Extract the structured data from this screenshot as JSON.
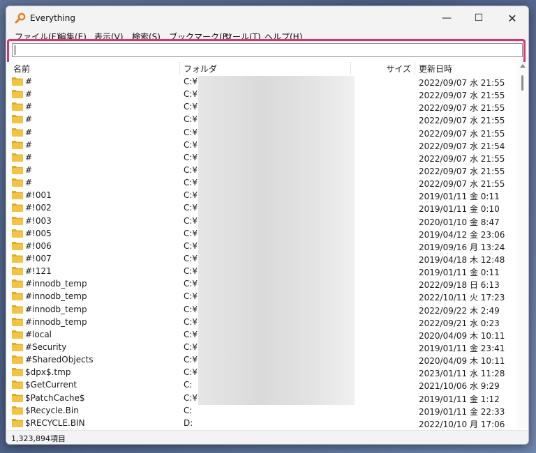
{
  "window": {
    "title": "Everything",
    "controls": {
      "minimize": "—",
      "maximize": "☐",
      "close": "✕"
    }
  },
  "menu": [
    "ファイル(F)",
    "編集(E)",
    "表示(V)",
    "検索(S)",
    "ブックマーク(B)",
    "ツール(T)",
    "ヘルプ(H)"
  ],
  "search": {
    "value": "",
    "placeholder": ""
  },
  "columns": {
    "name": "名前",
    "folder": "フォルダ",
    "size": "サイズ",
    "modified": "更新日時"
  },
  "rows": [
    {
      "name": "#",
      "folder": "C:¥",
      "modified": "2022/09/07 水 21:55"
    },
    {
      "name": "#",
      "folder": "C:¥",
      "modified": "2022/09/07 水 21:55"
    },
    {
      "name": "#",
      "folder": "C:¥",
      "modified": "2022/09/07 水 21:55"
    },
    {
      "name": "#",
      "folder": "C:¥",
      "modified": "2022/09/07 水 21:55"
    },
    {
      "name": "#",
      "folder": "C:¥",
      "modified": "2022/09/07 水 21:55"
    },
    {
      "name": "#",
      "folder": "C:¥",
      "modified": "2022/09/07 水 21:54"
    },
    {
      "name": "#",
      "folder": "C:¥",
      "modified": "2022/09/07 水 21:55"
    },
    {
      "name": "#",
      "folder": "C:¥",
      "modified": "2022/09/07 水 21:55"
    },
    {
      "name": "#",
      "folder": "C:¥",
      "modified": "2022/09/07 水 21:55"
    },
    {
      "name": "#!001",
      "folder": "C:¥",
      "modified": "2019/01/11 金 0:11"
    },
    {
      "name": "#!002",
      "folder": "C:¥",
      "modified": "2019/01/11 金 0:10"
    },
    {
      "name": "#!003",
      "folder": "C:¥",
      "modified": "2020/01/10 金 8:47"
    },
    {
      "name": "#!005",
      "folder": "C:¥",
      "modified": "2019/04/12 金 23:06"
    },
    {
      "name": "#!006",
      "folder": "C:¥",
      "modified": "2019/09/16 月 13:24"
    },
    {
      "name": "#!007",
      "folder": "C:¥",
      "modified": "2019/04/18 木 12:48"
    },
    {
      "name": "#!121",
      "folder": "C:¥",
      "modified": "2019/01/11 金 0:11"
    },
    {
      "name": "#innodb_temp",
      "folder": "C:¥",
      "modified": "2022/09/18 日 6:13"
    },
    {
      "name": "#innodb_temp",
      "folder": "C:¥",
      "modified": "2022/10/11 火 17:23"
    },
    {
      "name": "#innodb_temp",
      "folder": "C:¥",
      "modified": "2022/09/22 木 2:49"
    },
    {
      "name": "#innodb_temp",
      "folder": "C:¥",
      "modified": "2022/09/21 水 0:23"
    },
    {
      "name": "#local",
      "folder": "C:¥",
      "modified": "2020/04/09 木 10:11"
    },
    {
      "name": "#Security",
      "folder": "C:¥",
      "modified": "2019/01/11 金 23:41"
    },
    {
      "name": "#SharedObjects",
      "folder": "C:¥",
      "modified": "2020/04/09 木 10:11"
    },
    {
      "name": "$dpx$.tmp",
      "folder": "C:¥",
      "modified": "2023/01/11 水 11:28"
    },
    {
      "name": "$GetCurrent",
      "folder": "C:",
      "modified": "2021/10/06 水 9:29"
    },
    {
      "name": "$PatchCache$",
      "folder": "C:¥",
      "modified": "2019/01/11 金 1:12"
    },
    {
      "name": "$Recycle.Bin",
      "folder": "C:",
      "modified": "2019/01/11 金 22:33"
    },
    {
      "name": "$RECYCLE.BIN",
      "folder": "D:",
      "modified": "2022/10/10 月 17:06"
    }
  ],
  "status": {
    "count_text": "1,323,894項目"
  },
  "colors": {
    "highlight": "#e4306c",
    "folder": "#f5c342",
    "app_icon": "#e8801a"
  },
  "icons": {
    "app": "magnifier-icon",
    "row": "folder-icon"
  }
}
